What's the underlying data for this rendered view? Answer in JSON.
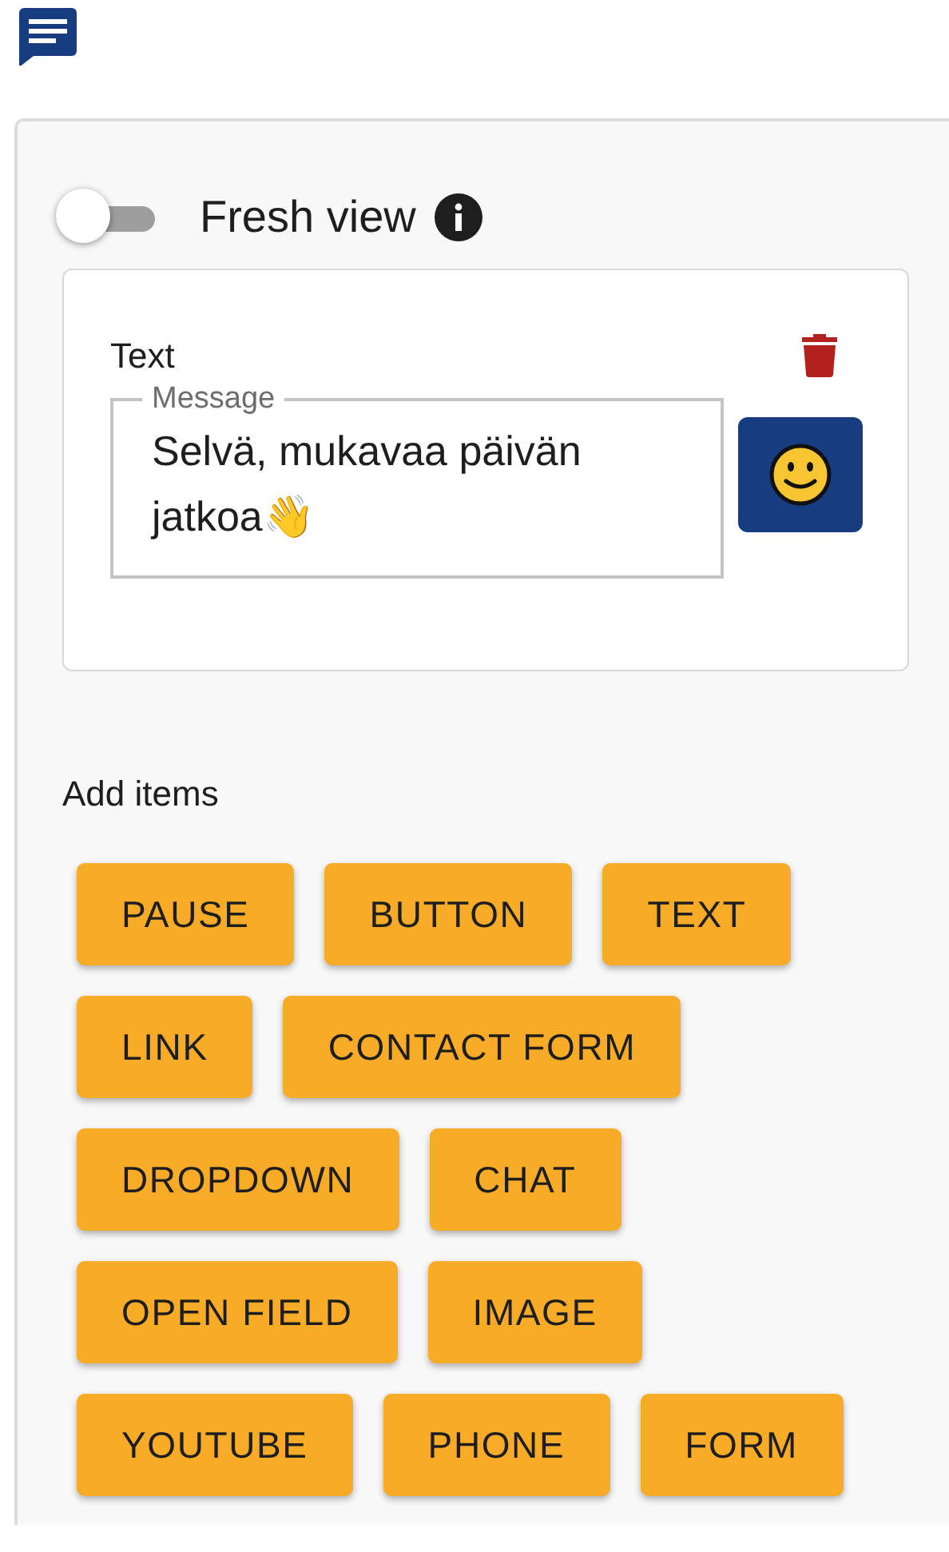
{
  "toggle": {
    "label": "Fresh view",
    "on": false
  },
  "item": {
    "title": "Text",
    "message": {
      "label": "Message",
      "value": "Selvä, mukavaa päivän jatkoa👋"
    }
  },
  "add_items": {
    "title": "Add items",
    "rows": [
      [
        "PAUSE",
        "BUTTON",
        "TEXT"
      ],
      [
        "LINK",
        "CONTACT FORM"
      ],
      [
        "DROPDOWN",
        "CHAT"
      ],
      [
        "OPEN FIELD",
        "IMAGE"
      ],
      [
        "YOUTUBE",
        "PHONE",
        "FORM"
      ]
    ]
  }
}
